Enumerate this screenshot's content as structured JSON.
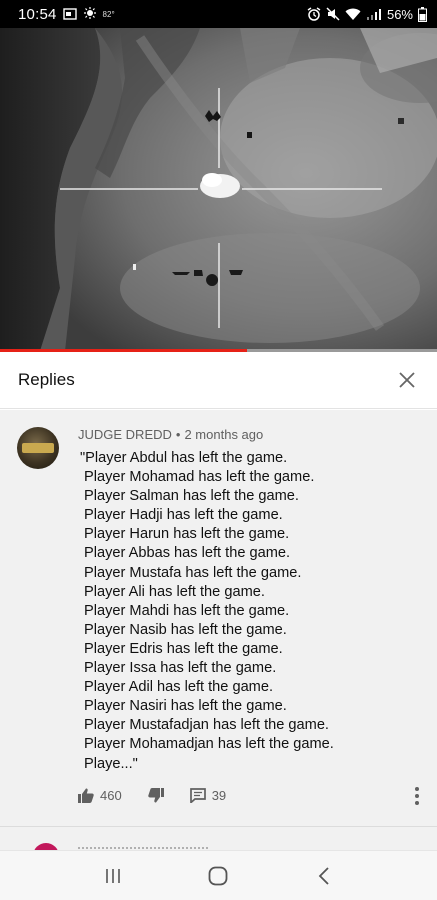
{
  "status_bar": {
    "time": "10:54",
    "temperature": "82°",
    "battery": "56%",
    "icons": [
      "gallery-icon",
      "weather-icon",
      "alarm-icon",
      "mute-icon",
      "wifi-icon",
      "signal-icon",
      "battery-icon"
    ]
  },
  "video": {
    "progress": 0.565,
    "accent_color": "#e62117"
  },
  "replies_panel": {
    "title": "Replies",
    "close_icon": "close-icon"
  },
  "comment": {
    "author": "JUDGE DREDD",
    "separator": "•",
    "age": "2 months ago",
    "lines": [
      "\"Player Abdul has left the game.",
      "Player Mohamad has left the game.",
      "Player Salman has left the game.",
      "Player Hadji has left the game.",
      "Player Harun has left the game.",
      "Player Abbas has left the game.",
      "Player Mustafa has left the game.",
      "Player Ali has left the game.",
      "Player Mahdi has left the game.",
      "Player Nasib has left the game.",
      "Player Edris has left the game.",
      "Player Issa has left the game.",
      "Player Adil has left the game.",
      "Player Nasiri has left the game.",
      "Player Mustafadjan has left the game.",
      "Player Mohamadjan has left the game.",
      "Playe...\""
    ],
    "likes": "460",
    "replies": "39"
  },
  "nav_bar": {
    "buttons": [
      "recents-icon",
      "home-icon",
      "back-icon"
    ]
  }
}
